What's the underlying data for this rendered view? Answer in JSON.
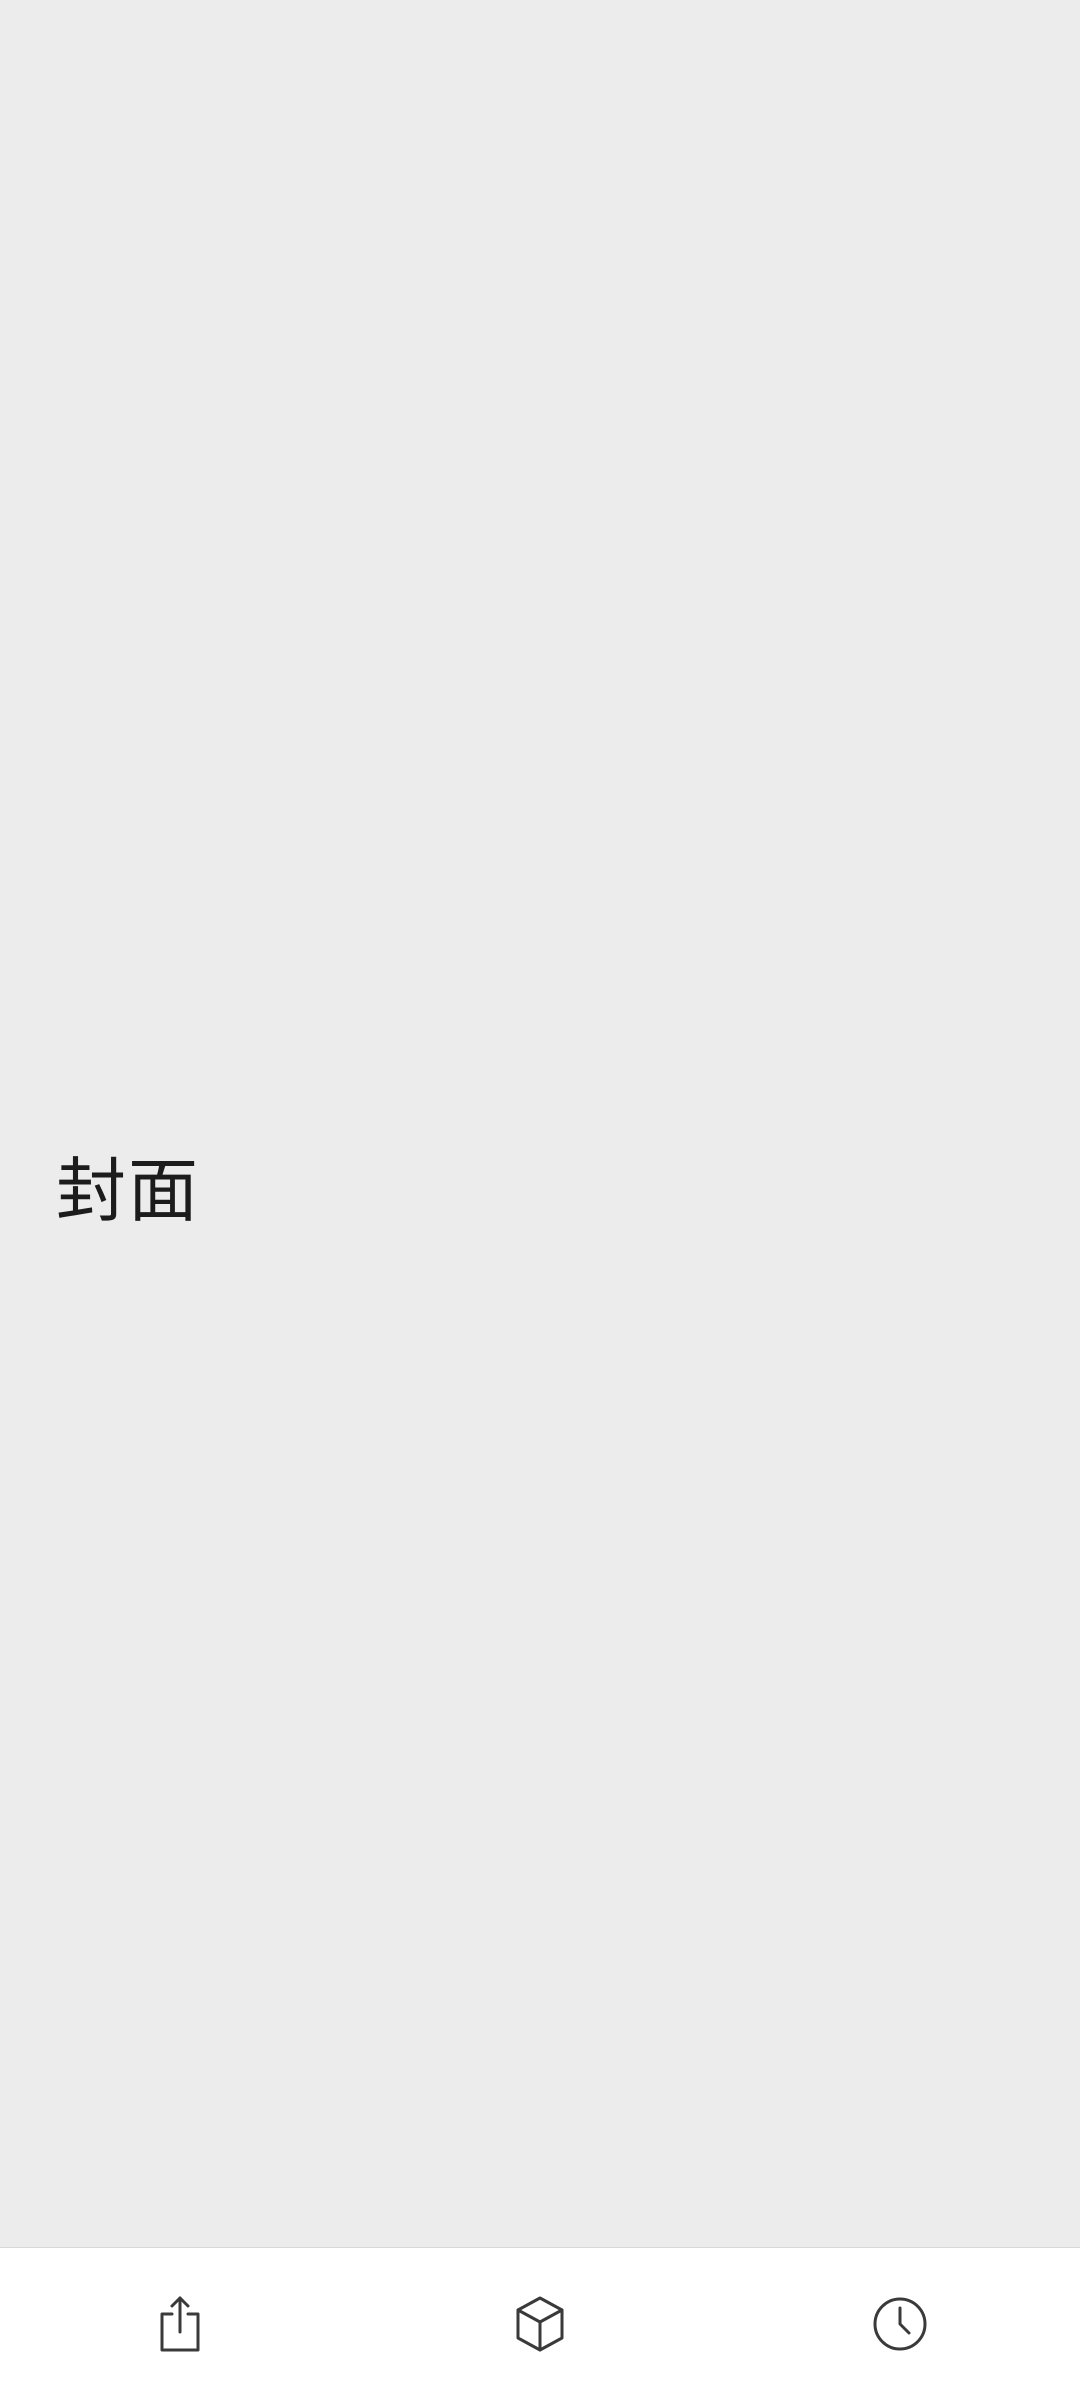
{
  "cover": {
    "title": "封面"
  },
  "bottom_bar": {
    "buttons": [
      {
        "icon": "share-icon"
      },
      {
        "icon": "cube-icon"
      },
      {
        "icon": "clock-icon"
      }
    ]
  },
  "colors": {
    "background": "#ececec",
    "bar_background": "#ffffff",
    "icon": "#3a3a3a",
    "text": "#1c1c1c"
  }
}
